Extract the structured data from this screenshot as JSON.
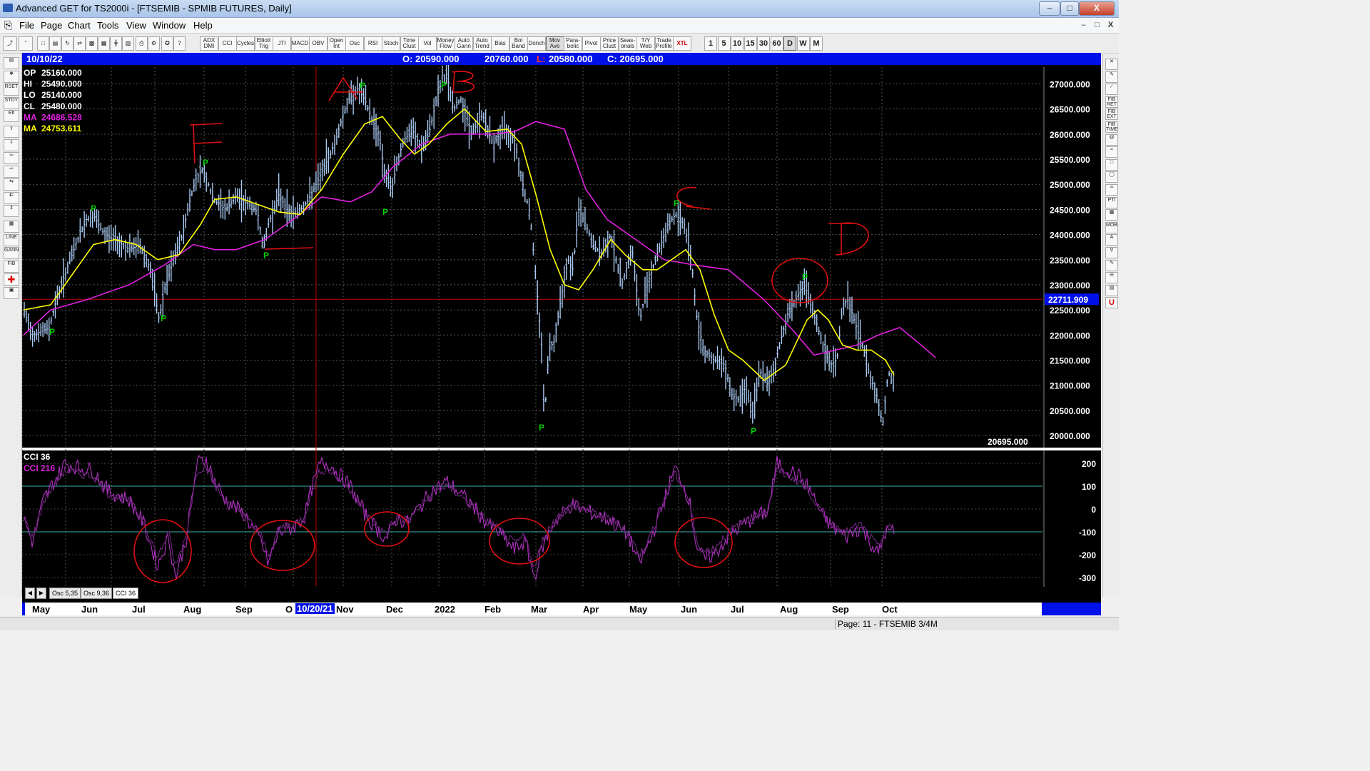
{
  "window": {
    "title": "Advanced GET for TS2000i - [FTSEMIB - SPMIB FUTURES, Daily]",
    "min": "‒",
    "max": "□",
    "close": "X"
  },
  "menu": [
    "File",
    "Page",
    "Chart",
    "Tools",
    "View",
    "Window",
    "Help"
  ],
  "toolbar": {
    "study_buttons": [
      "ADX DMI",
      "CCI",
      "Cycles",
      "Elliott Trig",
      "JTI",
      "MACD",
      "OBV",
      "Open Int",
      "Osc",
      "RSI",
      "Stoch",
      "Time Clust",
      "Vol",
      "Money Flow",
      "Auto Gann",
      "Auto Trend",
      "Bias",
      "Bol Band",
      "Donch",
      "Mov Ave",
      "Para-bolic",
      "Pivot",
      "Price Clust",
      "Seas-onals",
      "T/Y Web",
      "Trade Profile",
      "XTL"
    ],
    "interval_buttons": [
      "1",
      "5",
      "10",
      "15",
      "30",
      "60",
      "D",
      "W",
      "M"
    ],
    "active_interval": "D"
  },
  "quote": {
    "date": "10/10/22",
    "open": "O: 20590.000",
    "high": "20760.000",
    "low_label": "L:",
    "low": "20580.000",
    "close": "C: 20695.000"
  },
  "readout": [
    {
      "label": "OP",
      "value": "25160.000",
      "color": "#ffffff"
    },
    {
      "label": "HI",
      "value": "25490.000",
      "color": "#ffffff"
    },
    {
      "label": "LO",
      "value": "25140.000",
      "color": "#ffffff"
    },
    {
      "label": "CL",
      "value": "25480.000",
      "color": "#ffffff"
    },
    {
      "label": "MA",
      "value": "24686.528",
      "color": "#e020e0"
    },
    {
      "label": "MA",
      "value": "24753.611",
      "color": "#ffff00"
    }
  ],
  "price_axis": {
    "ticks": [
      "27000.000",
      "26500.000",
      "26000.000",
      "25500.000",
      "25000.000",
      "24500.000",
      "24000.000",
      "23500.000",
      "23000.000",
      "22500.000",
      "22000.000",
      "21500.000",
      "21000.000",
      "20500.000",
      "20000.000"
    ],
    "highlight": "22711.909",
    "last_price": "20695.000"
  },
  "cci": {
    "label1": "CCI 36",
    "label2": "CCI  216",
    "ticks": [
      "200",
      "100",
      "0",
      "-100",
      "-200",
      "-300"
    ]
  },
  "osc_tabs": [
    "Osc 5,35",
    "Osc 9,36",
    "CCI 36"
  ],
  "time_axis": [
    "May",
    "Jun",
    "Jul",
    "Aug",
    "Sep",
    "O",
    "Nov",
    "Dec",
    "2022",
    "Feb",
    "Mar",
    "Apr",
    "May",
    "Jun",
    "Jul",
    "Aug",
    "Sep",
    "Oct"
  ],
  "cursor_date": "10/20/21",
  "pivot_marker": "P",
  "annotations": [
    "F",
    "A",
    "B",
    "C",
    "D"
  ],
  "status": {
    "page": "Page: 11 - FTSEMIB 3/4M"
  },
  "colors": {
    "chart_bg": "#000000",
    "bars": "#a8c8f0",
    "ma_slow": "#e020e0",
    "ma_fast": "#ffff00",
    "pivot": "#00d000",
    "annotation": "#e01010",
    "quote_bar": "#0010e8"
  },
  "chart_data": {
    "type": "line",
    "x": [
      "2021-05",
      "2021-06",
      "2021-07",
      "2021-08",
      "2021-09",
      "2021-10",
      "2021-11",
      "2021-12",
      "2022-01",
      "2022-02",
      "2022-03",
      "2022-04",
      "2022-05",
      "2022-06",
      "2022-07",
      "2022-08",
      "2022-09",
      "2022-10"
    ],
    "series": [
      {
        "name": "MA",
        "values": [
          22100,
          22750,
          23000,
          23300,
          24250,
          24600,
          24800,
          25600,
          26000,
          26000,
          26250,
          24700,
          23700,
          23500,
          23300,
          21800,
          21700,
          22100
        ]
      },
      {
        "name": "MA",
        "values": [
          22500,
          24000,
          23700,
          24500,
          24700,
          24450,
          26000,
          25700,
          26600,
          26000,
          22800,
          23800,
          23400,
          23700,
          21500,
          21500,
          21800,
          21300
        ]
      }
    ],
    "close_path": [
      22800,
      24200,
      22900,
      25200,
      24500,
      24700,
      26900,
      25800,
      27200,
      26300,
      21000,
      24400,
      22800,
      24500,
      20500,
      22900,
      22300,
      20695
    ],
    "ylim": [
      20000,
      27000
    ],
    "cci_ylim": [
      -300,
      200
    ]
  }
}
